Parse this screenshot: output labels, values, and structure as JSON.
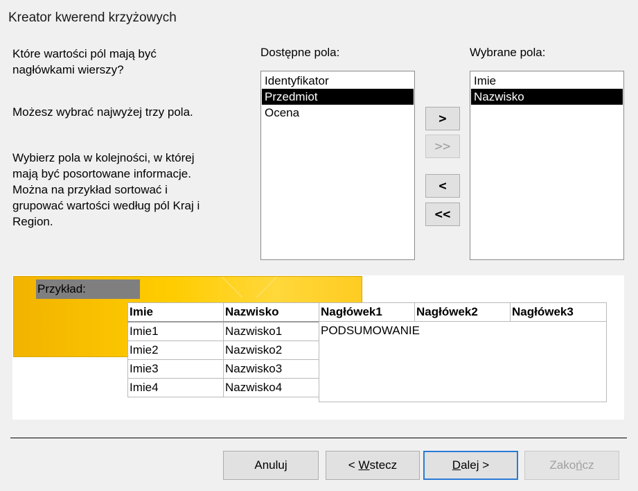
{
  "window": {
    "title": "Kreator kwerend krzyżowych"
  },
  "instructions": {
    "question_line1": "Które wartości pól mają być",
    "question_line2": "nagłówkami wierszy?",
    "limit": "Możesz wybrać najwyżej trzy pola.",
    "order_lines": [
      "Wybierz pola w kolejności, w której",
      "mają być posortowane informacje.",
      "Można na przykład sortować i",
      "grupować wartości według pól Kraj i",
      "Region."
    ]
  },
  "available": {
    "label": "Dostępne pola:",
    "items": [
      "Identyfikator",
      "Przedmiot",
      "Ocena"
    ],
    "selected_index": 1
  },
  "selected": {
    "label": "Wybrane pola:",
    "items": [
      "Imie",
      "Nazwisko"
    ],
    "selected_index": 1
  },
  "move_buttons": {
    "add_one": ">",
    "add_all": ">>",
    "remove_one": "<",
    "remove_all": "<<"
  },
  "sample": {
    "label": "Przykład:",
    "row_headers": [
      "Imie",
      "Nazwisko"
    ],
    "rows": [
      [
        "Imie1",
        "Nazwisko1"
      ],
      [
        "Imie2",
        "Nazwisko2"
      ],
      [
        "Imie3",
        "Nazwisko3"
      ],
      [
        "Imie4",
        "Nazwisko4"
      ]
    ],
    "column_headers": [
      "Nagłówek1",
      "Nagłówek2",
      "Nagłówek3"
    ],
    "summary": "PODSUMOWANIE"
  },
  "buttons": {
    "cancel": "Anuluj",
    "back_prefix": "< ",
    "back_accel": "W",
    "back_rest": "stecz",
    "next_accel": "D",
    "next_rest": "alej >",
    "finish_pre": "Zako",
    "finish_accel": "ń",
    "finish_rest": "cz"
  }
}
